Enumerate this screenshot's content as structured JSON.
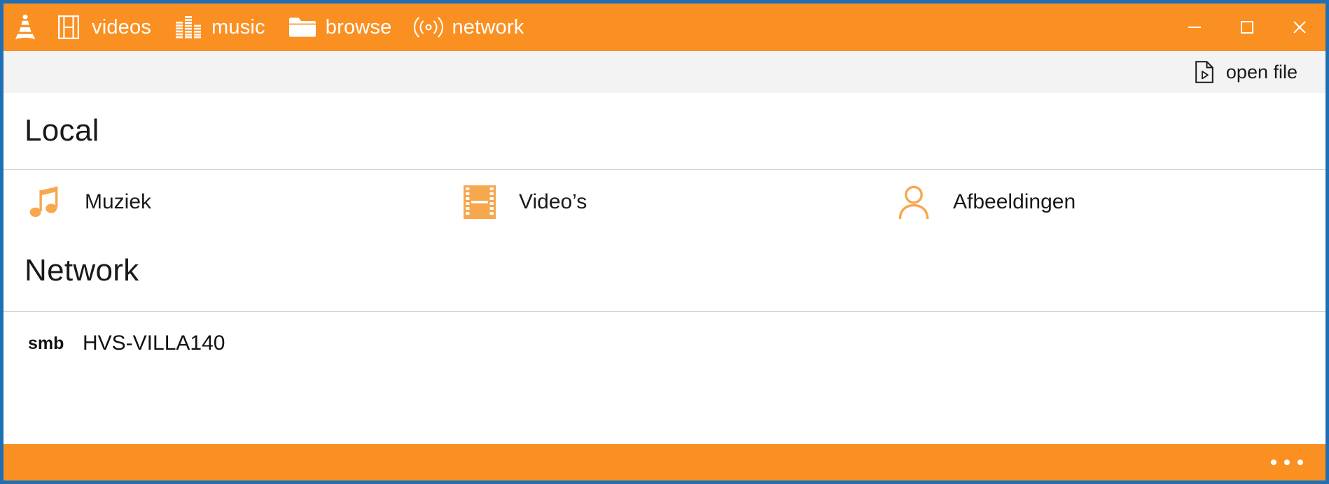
{
  "theme": {
    "accent_orange": "#FA9022",
    "icon_orange": "#F7A74E",
    "window_border_blue": "#1E6FB4",
    "toolbar_gray": "#F3F3F3",
    "divider_gray": "#D2D2D2",
    "text_dark": "#1A1A1A"
  },
  "titlebar": {
    "app_icon": "vlc-cone-logo",
    "tabs": [
      {
        "icon": "film-strip-icon",
        "label": "videos"
      },
      {
        "icon": "equalizer-icon",
        "label": "music"
      },
      {
        "icon": "folder-icon",
        "label": "browse"
      },
      {
        "icon": "broadcast-icon",
        "label": "network"
      }
    ],
    "window_controls": [
      {
        "name": "minimize",
        "glyph": "—"
      },
      {
        "name": "maximize",
        "glyph": "□"
      },
      {
        "name": "close",
        "glyph": "✕"
      }
    ]
  },
  "toolbar": {
    "open_file": {
      "icon": "document-play-icon",
      "label": "open file"
    }
  },
  "main": {
    "sections": [
      {
        "id": "local",
        "heading": "Local",
        "items": [
          {
            "icon": "music-note-icon",
            "label": "Muziek"
          },
          {
            "icon": "film-strip-icon",
            "label": "Video’s"
          },
          {
            "icon": "person-icon",
            "label": "Afbeeldingen"
          }
        ]
      },
      {
        "id": "network",
        "heading": "Network",
        "items": [
          {
            "protocol": "smb",
            "name": "HVS-VILLA140"
          }
        ]
      }
    ]
  },
  "bottombar": {
    "more_button": {
      "icon": "ellipsis-icon",
      "label": "• • •"
    }
  }
}
